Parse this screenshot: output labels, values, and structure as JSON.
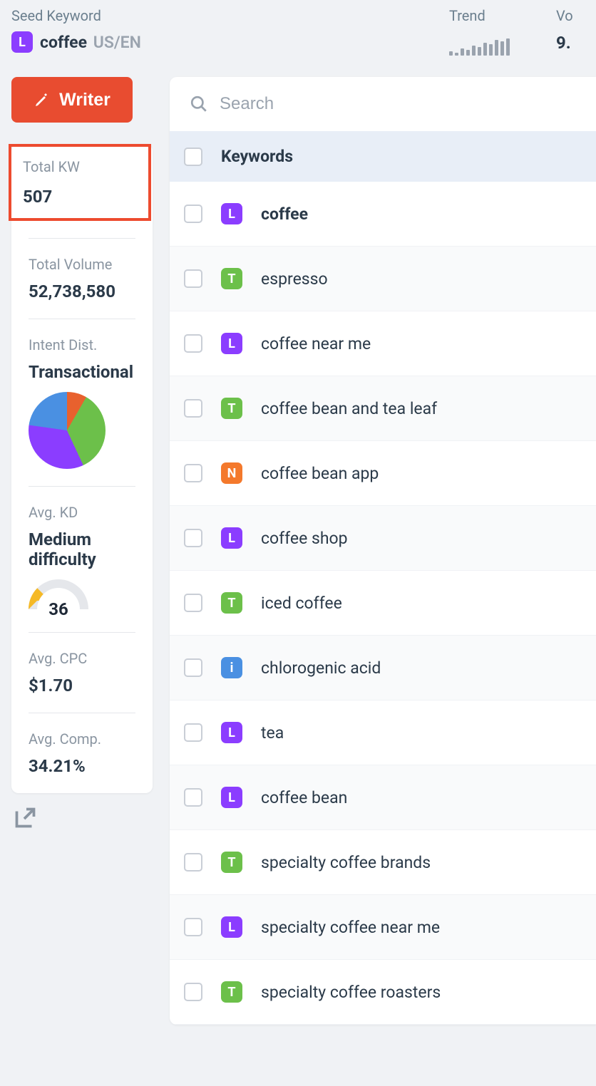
{
  "header": {
    "seed_label": "Seed Keyword",
    "seed_intent": "L",
    "seed_keyword": "coffee",
    "seed_locale": "US/EN",
    "trend_label": "Trend",
    "volume_label": "Vo",
    "volume_value": "9."
  },
  "writer_button": "Writer",
  "stats": {
    "total_kw": {
      "label": "Total KW",
      "value": "507"
    },
    "total_volume": {
      "label": "Total Volume",
      "value": "52,738,580"
    },
    "intent_dist": {
      "label": "Intent Dist.",
      "value": "Transactional"
    },
    "avg_kd": {
      "label": "Avg. KD",
      "value": "Medium difficulty",
      "number": "36"
    },
    "avg_cpc": {
      "label": "Avg. CPC",
      "value": "$1.70"
    },
    "avg_comp": {
      "label": "Avg. Comp.",
      "value": "34.21%"
    }
  },
  "search_placeholder": "Search",
  "table": {
    "keywords_header": "Keywords",
    "rows": [
      {
        "intent": "L",
        "keyword": "coffee",
        "bold": true
      },
      {
        "intent": "T",
        "keyword": "espresso"
      },
      {
        "intent": "L",
        "keyword": "coffee near me"
      },
      {
        "intent": "T",
        "keyword": "coffee bean and tea leaf"
      },
      {
        "intent": "N",
        "keyword": "coffee bean app"
      },
      {
        "intent": "L",
        "keyword": "coffee shop"
      },
      {
        "intent": "T",
        "keyword": "iced coffee"
      },
      {
        "intent": "i",
        "keyword": "chlorogenic acid"
      },
      {
        "intent": "L",
        "keyword": "tea"
      },
      {
        "intent": "L",
        "keyword": "coffee bean"
      },
      {
        "intent": "T",
        "keyword": "specialty coffee brands"
      },
      {
        "intent": "L",
        "keyword": "specialty coffee near me"
      },
      {
        "intent": "T",
        "keyword": "specialty coffee roasters"
      }
    ]
  },
  "sparkline_heights": [
    6,
    4,
    10,
    8,
    14,
    12,
    18,
    16,
    22,
    20,
    24
  ]
}
